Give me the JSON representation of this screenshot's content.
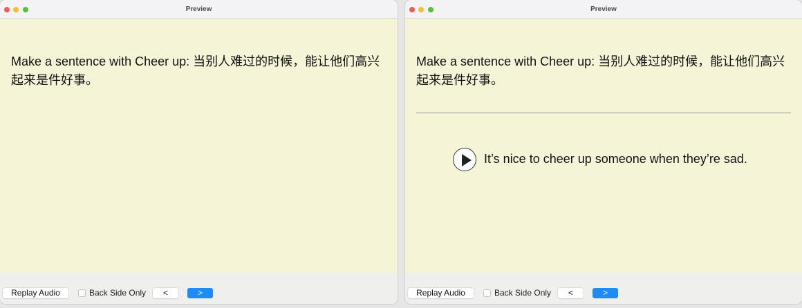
{
  "window": {
    "title": "Preview"
  },
  "card": {
    "front": "Make a sentence with Cheer up: 当别人难过的时候，能让他们高兴起来是件好事。",
    "back": "It’s nice to cheer up someone when they’re sad."
  },
  "controls": {
    "replay_label": "Replay Audio",
    "back_side_only_label": "Back Side Only",
    "back_side_only_checked": false,
    "prev_label": "<",
    "next_label": ">"
  },
  "colors": {
    "card_background": "#f5f4d7",
    "accent": "#1f8bf7"
  },
  "icons": {
    "play": "play-icon"
  }
}
